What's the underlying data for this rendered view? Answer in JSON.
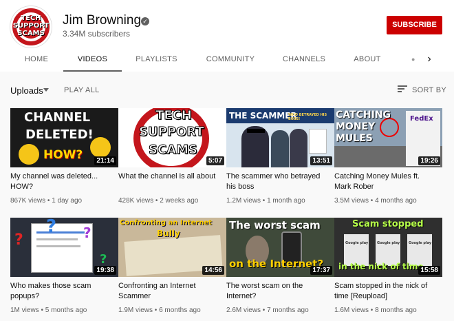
{
  "channel": {
    "name": "Jim Browning",
    "subscribers": "3.34M subscribers",
    "avatar_text": "TECH\nSUPPORT\nSCAMS",
    "subscribe_label": "SUBSCRIBE"
  },
  "tabs": [
    {
      "label": "HOME"
    },
    {
      "label": "VIDEOS",
      "active": true
    },
    {
      "label": "PLAYLISTS"
    },
    {
      "label": "COMMUNITY"
    },
    {
      "label": "CHANNELS"
    },
    {
      "label": "ABOUT"
    }
  ],
  "filter": {
    "uploads_label": "Uploads",
    "play_all_label": "PLAY ALL",
    "sort_label": "SORT BY"
  },
  "videos": [
    {
      "title": "My channel was deleted... HOW?",
      "meta": "867K views • 1 day ago",
      "duration": "21:14",
      "thumb_text": [
        "CHANNEL",
        "DELETED!",
        "HOW?"
      ]
    },
    {
      "title": "What the channel is all about",
      "meta": "428K views • 2 weeks ago",
      "duration": "5:07",
      "thumb_text": [
        "TECH",
        "SUPPORT",
        "SCAMS"
      ]
    },
    {
      "title": "The scammer who betrayed his boss",
      "meta": "1.2M views • 1 month ago",
      "duration": "13:51",
      "thumb_text": [
        "THE SCAMMER",
        "WHO BETRAYED HIS BOSS!"
      ]
    },
    {
      "title": "Catching Money Mules ft. Mark Rober",
      "meta": "3.5M views • 4 months ago",
      "duration": "19:26",
      "thumb_text": [
        "CATCHING",
        "MONEY",
        "MULES",
        "FedEx"
      ]
    },
    {
      "title": "Who makes those scam popups?",
      "meta": "1M views • 5 months ago",
      "duration": "19:38",
      "thumb_text": []
    },
    {
      "title": "Confronting an Internet Scammer",
      "meta": "1.9M views • 6 months ago",
      "duration": "14:56",
      "thumb_text": [
        "Confronting an Internet",
        "Bully"
      ]
    },
    {
      "title": "The worst scam on the Internet?",
      "meta": "2.6M views • 7 months ago",
      "duration": "17:37",
      "thumb_text": [
        "The worst scam",
        "on the Internet?"
      ]
    },
    {
      "title": "Scam stopped in the nick of time [Reupload]",
      "meta": "1.6M views • 8 months ago",
      "duration": "15:58",
      "thumb_text": [
        "Scam stopped",
        "in the nick of time",
        "Google play"
      ]
    }
  ],
  "colors": {
    "brand_red": "#cc0000",
    "background": "#f9f9f9",
    "text_secondary": "#606060"
  },
  "icons": {
    "verified": "verified-check-icon",
    "sort": "sort-lines-icon",
    "next_tabs": "chevron-right-icon",
    "uploads_dropdown": "caret-down-icon"
  }
}
